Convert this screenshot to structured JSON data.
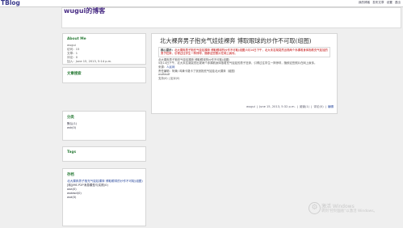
{
  "topbar": {
    "brand": "TBlog",
    "links": [
      "我的博客",
      "发布文章",
      "设置",
      "退出"
    ]
  },
  "header": {
    "site_title": "wugui的博客"
  },
  "about": {
    "title": "About Me",
    "lines": [
      "wugui",
      "访问：15",
      "文章：1",
      "评论：0",
      "加入：June 15, 2013, 5:14 p.m."
    ]
  },
  "search": {
    "title": "文章搜索"
  },
  "categories": {
    "title": "分类",
    "items": [
      "默认(1)",
      "ask(0)"
    ]
  },
  "tags": {
    "title": "Tags"
  },
  "archives": {
    "title": "存档",
    "items": [
      "北大裸奔男子抱充气娃娃裸奔 博取眼球的炒作不可取(组图)",
      "[转]JMS P2P消息模型与实践(0)",
      "aaa(0)",
      "asdasd(0)",
      "asd(0)"
    ]
  },
  "post": {
    "title": "北大裸奔男子抱充气娃娃裸奔 博取眼球的炒作不可取(组图)",
    "excerpt_label": "核心提示：",
    "excerpt_text": "北大裸奔男子抱充气娃娃裸奔 博取眼球的炒作不可取(组图)5月14日下午，北大未名湖突然出现两个赤裸着身体抱着充气娃娃的男子狂奔，引得过往学生一阵惊呼，随即这些照片在网上疯传。",
    "lines": [
      "北大裸奔男子抱充气娃娃裸奔 博取眼球的炒作不可取(组图)",
      "5月14日下午，北大未名湖突然出现两个赤裸着身体抱着充气娃娃的男子狂奔，引得过往学生一阵惊呼，随即这些照片在网上疯传。"
    ],
    "source_label": "来源：",
    "source_link": "人民网",
    "editor_line": "责任编辑：阿黄/ 鸡黄卡路卡了张张抱充气娃娃北大裸奔（组图）",
    "tail": "asdfasdf",
    "footer": "支持(0)  |  反对(0)",
    "meta": {
      "author": "wugui",
      "date": "June 15, 2013, 5:32 p.m.",
      "views": "阅读(1)",
      "comments": "评论(0)",
      "edit": "编辑"
    }
  },
  "watermark": {
    "icon": "windows-activation-icon",
    "title": "激活 Windows",
    "subtitle": "转到\"控制面板\"以激活 Windows。"
  }
}
